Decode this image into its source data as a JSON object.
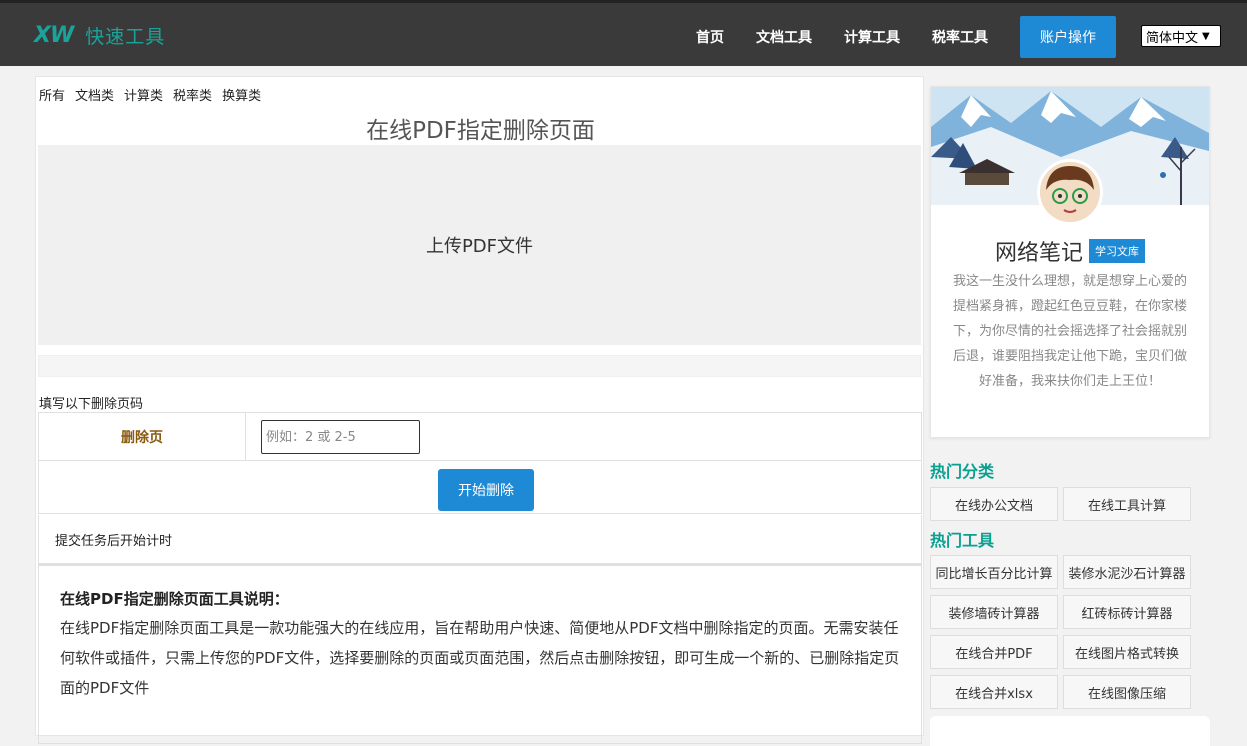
{
  "header": {
    "logo_mark": "XW",
    "logo_text": "快速工具",
    "nav": [
      "首页",
      "文档工具",
      "计算工具",
      "税率工具"
    ],
    "account_button": "账户操作",
    "language": "简体中文"
  },
  "main": {
    "categories": [
      "所有",
      "文档类",
      "计算类",
      "税率类",
      "换算类"
    ],
    "title": "在线PDF指定删除页面",
    "upload_label": "上传PDF文件",
    "progress": 0,
    "fill_label": "填写以下删除页码",
    "form_label": "删除页",
    "form_placeholder": "例如：2 或 2-5",
    "form_value": "",
    "start_button": "开始删除",
    "timer_text": "提交任务后开始计时",
    "desc_title": "在线PDF指定删除页面工具说明：",
    "desc_body": "在线PDF指定删除页面工具是一款功能强大的在线应用，旨在帮助用户快速、简便地从PDF文档中删除指定的页面。无需安装任何软件或插件，只需上传您的PDF文件，选择要删除的页面或页面范围，然后点击删除按钮，即可生成一个新的、已删除指定页面的PDF文件"
  },
  "sidebar": {
    "name": "网络笔记",
    "badge": "学习文库",
    "bio": "我这一生没什么理想，就是想穿上心爱的提档紧身裤，蹬起红色豆豆鞋，在你家楼下，为你尽情的社会摇选择了社会摇就别后退，谁要阻挡我定让他下跪，宝贝们做好准备，我来扶你们走上王位！",
    "hot_categories_title": "热门分类",
    "hot_categories": [
      "在线办公文档",
      "在线工具计算"
    ],
    "hot_tools_title": "热门工具",
    "hot_tools": [
      "同比增长百分比计算",
      "装修水泥沙石计算器",
      "装修墙砖计算器",
      "红砖标砖计算器",
      "在线合并PDF",
      "在线图片格式转换",
      "在线合并xlsx",
      "在线图像压缩"
    ]
  },
  "colors": {
    "header_bg": "#3a3a3a",
    "brand_teal": "#1aa39a",
    "accent_blue": "#1e8ad6",
    "section_teal": "#0aa08f"
  }
}
